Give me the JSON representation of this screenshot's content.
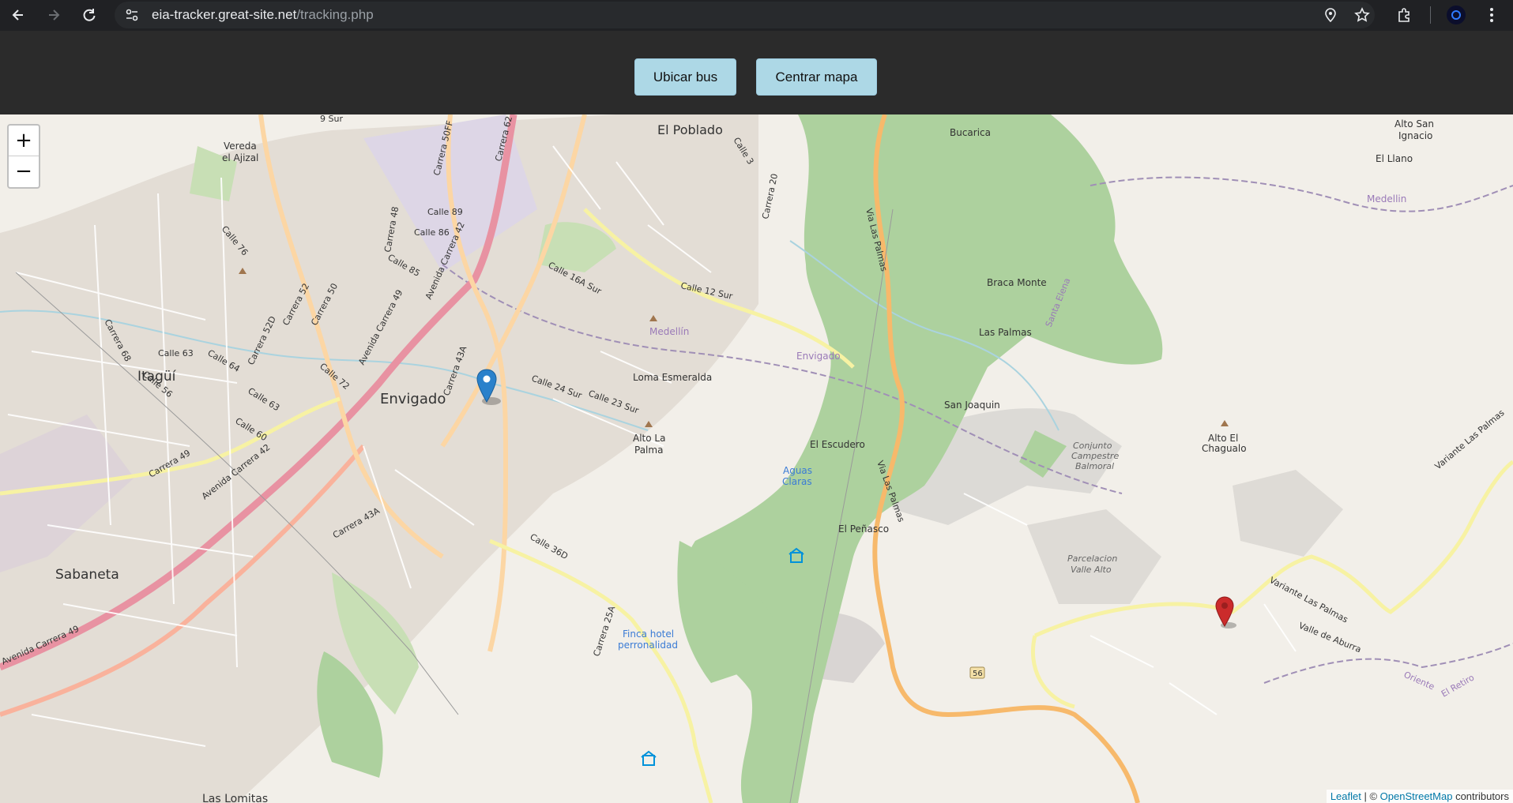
{
  "browser": {
    "url_host": "eia-tracker.great-site.net",
    "url_path": "/tracking.php",
    "icons": [
      "back-icon",
      "forward-icon",
      "reload-icon",
      "site-info-icon",
      "location-icon",
      "star-icon",
      "extensions-icon",
      "profile-icon",
      "menu-icon"
    ]
  },
  "toolbar": {
    "locate_label": "Ubicar bus",
    "center_label": "Centrar mapa",
    "button_color": "#add8e6"
  },
  "map": {
    "zoom_in": "+",
    "zoom_out": "−",
    "attribution": {
      "leaflet": "Leaflet",
      "sep": " | © ",
      "osm": "OpenStreetMap",
      "suffix": " contributors"
    },
    "markers": [
      {
        "name": "bus-marker",
        "color": "#2a81cb"
      },
      {
        "name": "destination-marker",
        "color": "#cb2b2b"
      }
    ],
    "places": {
      "poblado": "El Poblado",
      "envigado": "Envigado",
      "itagui": "Itagüí",
      "sabaneta": "Sabaneta",
      "bucarica": "Bucarica",
      "braca": "Braca Monte",
      "laspalmas": "Las Palmas",
      "sanjoaquin": "San Joaquin",
      "escudero": "El Escudero",
      "penasco": "El Peñasco",
      "llano": "El Llano",
      "ajizal1": "Vereda",
      "ajizal2": "el Ajizal",
      "esmeralda": "Loma Esmeralda",
      "altopalma1": "Alto La",
      "altopalma2": "Palma",
      "aguas1": "Aguas",
      "aguas2": "Claras",
      "finca1": "Finca hotel",
      "finca2": "perronalidad",
      "chaguala1": "Alto El",
      "chaguala2": "Chagualo",
      "ignacio1": "Alto San",
      "ignacio2": "Ignacio",
      "balmoral1": "Conjunto",
      "balmoral2": "Campestre",
      "balmoral3": "Balmoral",
      "parcel1": "Parcelacion",
      "parcel2": "Valle Alto",
      "lomitas": "Las Lomitas",
      "medellin1": "Medellín",
      "medellin2": "Medellin",
      "envigado_river": "Envigado",
      "santaelena": "Santa Elena",
      "variante1": "Variante Las Palmas",
      "variante2": "Variante Las Palmas",
      "valle": "Valle de Aburra",
      "oriente": "Oriente",
      "retiro": "El Retiro",
      "via1": "Via Las Palmas",
      "via2": "Via Las Palmas",
      "road56": "56"
    },
    "streets": {
      "c89": "Calle 89",
      "c86": "Calle 86",
      "c85": "Calle 85",
      "c76": "Calle 76",
      "c64": "Calle 64",
      "c63": "Calle 63",
      "c63b": "Calle 63",
      "c60": "Calle 60",
      "c56": "Calle 56",
      "c72": "Calle 72",
      "k68": "Carrera 68",
      "k52d": "Carrera 52D",
      "k52": "Carrera 52",
      "k50": "Carrera 50",
      "k48": "Carrera 48",
      "k50ff": "Carrera 50FF",
      "k62": "Carrera 62",
      "k42": "Avenida Carrera 42",
      "k49": "Avenida Carrera 49",
      "k43a": "Carrera 43A",
      "k43a2": "Carrera 43A",
      "k49b": "Carrera 49",
      "k42b": "Avenida Carrera 42",
      "k49c": "Avenida Carrera 49",
      "c16a": "Calle 16A Sur",
      "c12": "Calle 12 Sur",
      "c24": "Calle 24 Sur",
      "c23": "Calle 23 Sur",
      "c36d": "Calle 36D",
      "k25a": "Carrera 25A",
      "k20": "Carrera 20",
      "c3": "Calle 3",
      "c9": "9 Sur"
    }
  }
}
